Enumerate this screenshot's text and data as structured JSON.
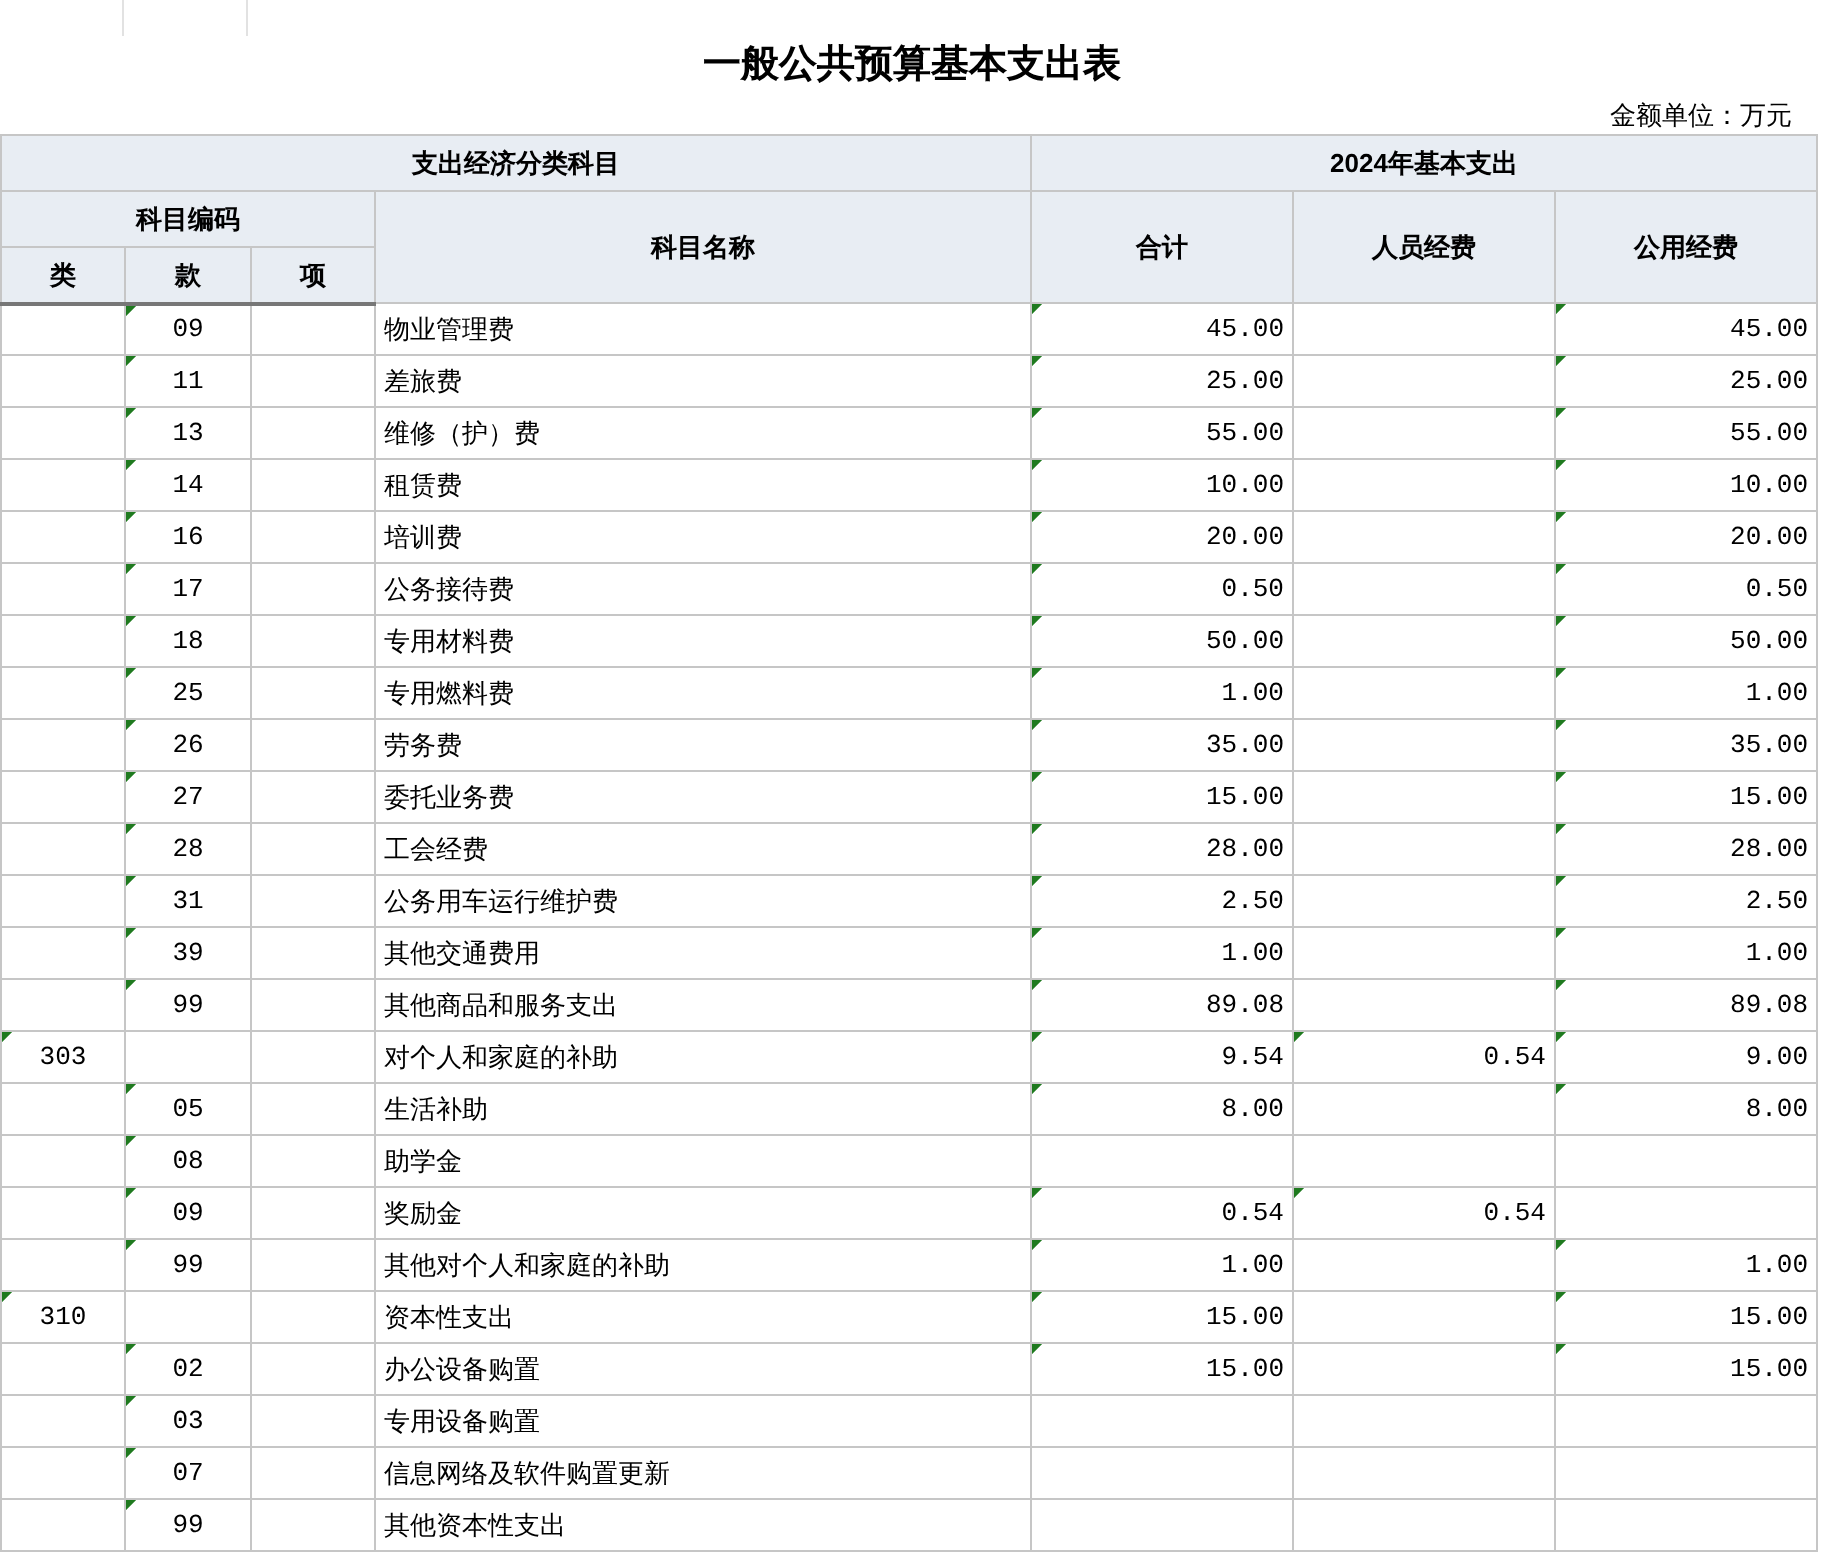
{
  "title": "一般公共预算基本支出表",
  "unit": "金额单位：万元",
  "header": {
    "group_left": "支出经济分类科目",
    "group_right": "2024年基本支出",
    "code_group": "科目编码",
    "name": "科目名称",
    "class": "类",
    "item": "款",
    "subitem": "项",
    "total": "合计",
    "personnel": "人员经费",
    "public": "公用经费"
  },
  "rows": [
    {
      "cells": [
        {
          "flagged": false
        },
        {
          "text": "09",
          "flagged": true
        },
        {
          "flagged": false
        },
        {
          "text": "物业管理费",
          "flagged": false
        },
        {
          "text": "45.00",
          "flagged": true
        },
        {
          "flagged": false
        },
        {
          "text": "45.00",
          "flagged": true
        }
      ]
    },
    {
      "cells": [
        {
          "flagged": false
        },
        {
          "text": "11",
          "flagged": true
        },
        {
          "flagged": false
        },
        {
          "text": "差旅费",
          "flagged": false
        },
        {
          "text": "25.00",
          "flagged": true
        },
        {
          "flagged": false
        },
        {
          "text": "25.00",
          "flagged": true
        }
      ]
    },
    {
      "cells": [
        {
          "flagged": false
        },
        {
          "text": "13",
          "flagged": true
        },
        {
          "flagged": false
        },
        {
          "text": "维修（护）费",
          "flagged": false
        },
        {
          "text": "55.00",
          "flagged": true
        },
        {
          "flagged": false
        },
        {
          "text": "55.00",
          "flagged": true
        }
      ]
    },
    {
      "cells": [
        {
          "flagged": false
        },
        {
          "text": "14",
          "flagged": true
        },
        {
          "flagged": false
        },
        {
          "text": "租赁费",
          "flagged": false
        },
        {
          "text": "10.00",
          "flagged": true
        },
        {
          "flagged": false
        },
        {
          "text": "10.00",
          "flagged": true
        }
      ]
    },
    {
      "cells": [
        {
          "flagged": false
        },
        {
          "text": "16",
          "flagged": true
        },
        {
          "flagged": false
        },
        {
          "text": "培训费",
          "flagged": false
        },
        {
          "text": "20.00",
          "flagged": true
        },
        {
          "flagged": false
        },
        {
          "text": "20.00",
          "flagged": true
        }
      ]
    },
    {
      "cells": [
        {
          "flagged": false
        },
        {
          "text": "17",
          "flagged": true
        },
        {
          "flagged": false
        },
        {
          "text": "公务接待费",
          "flagged": false
        },
        {
          "text": "0.50",
          "flagged": true
        },
        {
          "flagged": false
        },
        {
          "text": "0.50",
          "flagged": true
        }
      ]
    },
    {
      "cells": [
        {
          "flagged": false
        },
        {
          "text": "18",
          "flagged": true
        },
        {
          "flagged": false
        },
        {
          "text": "专用材料费",
          "flagged": false
        },
        {
          "text": "50.00",
          "flagged": true
        },
        {
          "flagged": false
        },
        {
          "text": "50.00",
          "flagged": true
        }
      ]
    },
    {
      "cells": [
        {
          "flagged": false
        },
        {
          "text": "25",
          "flagged": true
        },
        {
          "flagged": false
        },
        {
          "text": "专用燃料费",
          "flagged": false
        },
        {
          "text": "1.00",
          "flagged": true
        },
        {
          "flagged": false
        },
        {
          "text": "1.00",
          "flagged": true
        }
      ]
    },
    {
      "cells": [
        {
          "flagged": false
        },
        {
          "text": "26",
          "flagged": true
        },
        {
          "flagged": false
        },
        {
          "text": "劳务费",
          "flagged": false
        },
        {
          "text": "35.00",
          "flagged": true
        },
        {
          "flagged": false
        },
        {
          "text": "35.00",
          "flagged": true
        }
      ]
    },
    {
      "cells": [
        {
          "flagged": false
        },
        {
          "text": "27",
          "flagged": true
        },
        {
          "flagged": false
        },
        {
          "text": "委托业务费",
          "flagged": false
        },
        {
          "text": "15.00",
          "flagged": true
        },
        {
          "flagged": false
        },
        {
          "text": "15.00",
          "flagged": true
        }
      ]
    },
    {
      "cells": [
        {
          "flagged": false
        },
        {
          "text": "28",
          "flagged": true
        },
        {
          "flagged": false
        },
        {
          "text": "工会经费",
          "flagged": false
        },
        {
          "text": "28.00",
          "flagged": true
        },
        {
          "flagged": false
        },
        {
          "text": "28.00",
          "flagged": true
        }
      ]
    },
    {
      "cells": [
        {
          "flagged": false
        },
        {
          "text": "31",
          "flagged": true
        },
        {
          "flagged": false
        },
        {
          "text": "公务用车运行维护费",
          "flagged": false
        },
        {
          "text": "2.50",
          "flagged": true
        },
        {
          "flagged": false
        },
        {
          "text": "2.50",
          "flagged": true
        }
      ]
    },
    {
      "cells": [
        {
          "flagged": false
        },
        {
          "text": "39",
          "flagged": true
        },
        {
          "flagged": false
        },
        {
          "text": "其他交通费用",
          "flagged": false
        },
        {
          "text": "1.00",
          "flagged": true
        },
        {
          "flagged": false
        },
        {
          "text": "1.00",
          "flagged": true
        }
      ]
    },
    {
      "cells": [
        {
          "flagged": false
        },
        {
          "text": "99",
          "flagged": true
        },
        {
          "flagged": false
        },
        {
          "text": "其他商品和服务支出",
          "flagged": false
        },
        {
          "text": "89.08",
          "flagged": true
        },
        {
          "flagged": false
        },
        {
          "text": "89.08",
          "flagged": true
        }
      ]
    },
    {
      "cells": [
        {
          "text": "303",
          "flagged": true
        },
        {
          "flagged": false
        },
        {
          "flagged": false
        },
        {
          "text": "对个人和家庭的补助",
          "flagged": false
        },
        {
          "text": "9.54",
          "flagged": true
        },
        {
          "text": "0.54",
          "flagged": true
        },
        {
          "text": "9.00",
          "flagged": true
        }
      ]
    },
    {
      "cells": [
        {
          "flagged": false
        },
        {
          "text": "05",
          "flagged": true
        },
        {
          "flagged": false
        },
        {
          "text": "生活补助",
          "flagged": false
        },
        {
          "text": "8.00",
          "flagged": true
        },
        {
          "flagged": false
        },
        {
          "text": "8.00",
          "flagged": true
        }
      ]
    },
    {
      "cells": [
        {
          "flagged": false
        },
        {
          "text": "08",
          "flagged": true
        },
        {
          "flagged": false
        },
        {
          "text": "助学金",
          "flagged": false
        },
        {
          "flagged": false
        },
        {
          "flagged": false
        },
        {
          "flagged": false
        }
      ]
    },
    {
      "cells": [
        {
          "flagged": false
        },
        {
          "text": "09",
          "flagged": true
        },
        {
          "flagged": false
        },
        {
          "text": "奖励金",
          "flagged": false
        },
        {
          "text": "0.54",
          "flagged": true
        },
        {
          "text": "0.54",
          "flagged": true
        },
        {
          "flagged": false
        }
      ]
    },
    {
      "cells": [
        {
          "flagged": false
        },
        {
          "text": "99",
          "flagged": true
        },
        {
          "flagged": false
        },
        {
          "text": "其他对个人和家庭的补助",
          "flagged": false
        },
        {
          "text": "1.00",
          "flagged": true
        },
        {
          "flagged": false
        },
        {
          "text": "1.00",
          "flagged": true
        }
      ]
    },
    {
      "cells": [
        {
          "text": "310",
          "flagged": true
        },
        {
          "flagged": false
        },
        {
          "flagged": false
        },
        {
          "text": "资本性支出",
          "flagged": false
        },
        {
          "text": "15.00",
          "flagged": true
        },
        {
          "flagged": false
        },
        {
          "text": "15.00",
          "flagged": true
        }
      ]
    },
    {
      "cells": [
        {
          "flagged": false
        },
        {
          "text": "02",
          "flagged": true
        },
        {
          "flagged": false
        },
        {
          "text": "办公设备购置",
          "flagged": false
        },
        {
          "text": "15.00",
          "flagged": true
        },
        {
          "flagged": false
        },
        {
          "text": "15.00",
          "flagged": true
        }
      ]
    },
    {
      "cells": [
        {
          "flagged": false
        },
        {
          "text": "03",
          "flagged": true
        },
        {
          "flagged": false
        },
        {
          "text": "专用设备购置",
          "flagged": false
        },
        {
          "flagged": false
        },
        {
          "flagged": false
        },
        {
          "flagged": false
        }
      ]
    },
    {
      "cells": [
        {
          "flagged": false
        },
        {
          "text": "07",
          "flagged": true
        },
        {
          "flagged": false
        },
        {
          "text": "信息网络及软件购置更新",
          "flagged": false
        },
        {
          "flagged": false
        },
        {
          "flagged": false
        },
        {
          "flagged": false
        }
      ]
    },
    {
      "cells": [
        {
          "flagged": false
        },
        {
          "text": "99",
          "flagged": true
        },
        {
          "flagged": false
        },
        {
          "text": "其他资本性支出",
          "flagged": false
        },
        {
          "flagged": false
        },
        {
          "flagged": false
        },
        {
          "flagged": false
        }
      ]
    }
  ]
}
